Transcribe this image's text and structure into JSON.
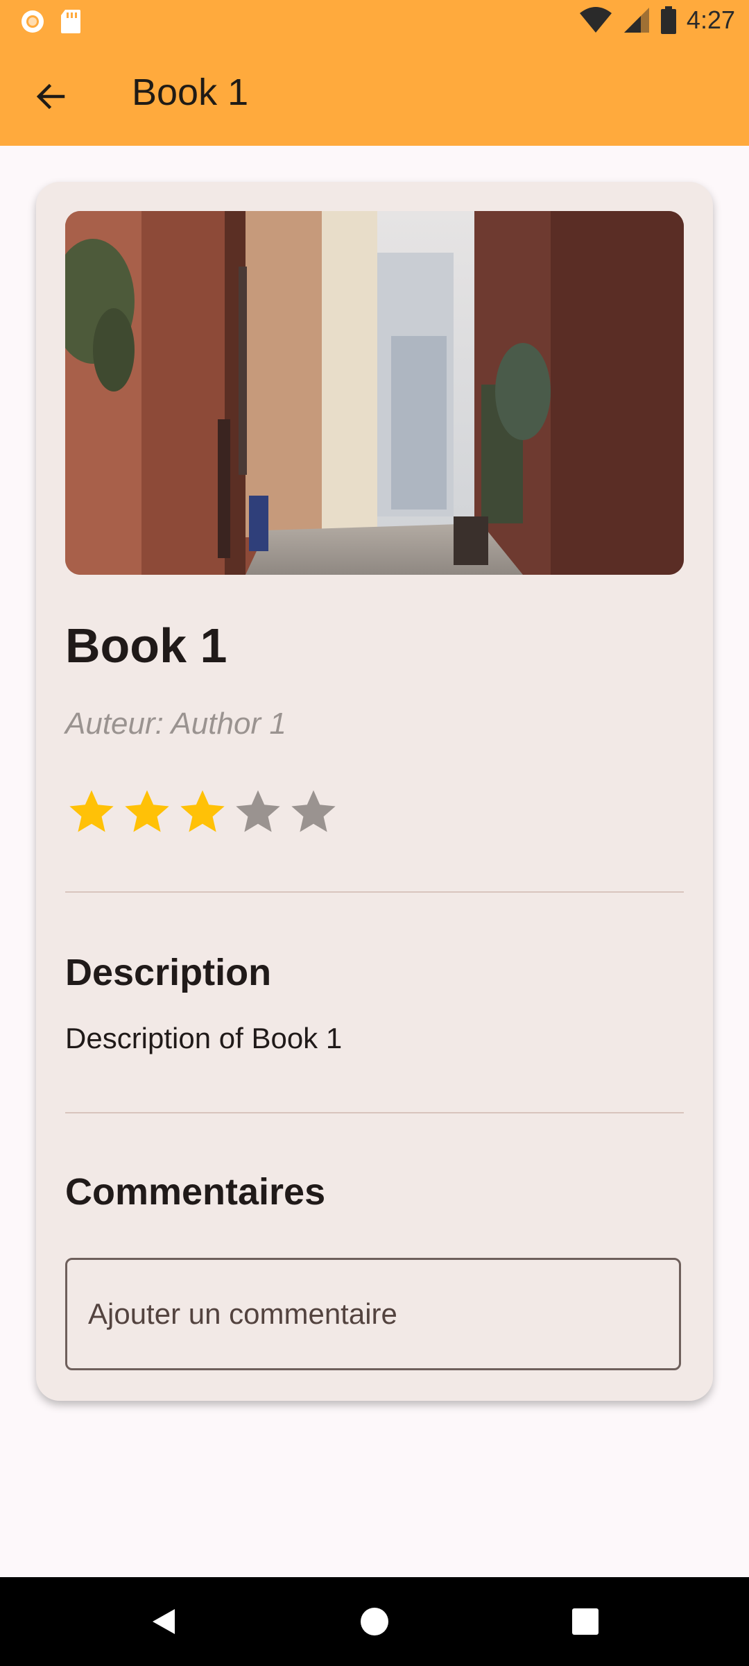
{
  "status_bar": {
    "time": "4:27",
    "left_icons": [
      "circle-notification-icon",
      "sd-card-icon"
    ],
    "right_icons": [
      "wifi-icon",
      "signal-icon",
      "battery-icon"
    ]
  },
  "app_bar": {
    "title": "Book 1",
    "back_icon": "arrow-back-icon",
    "background": "#ffaa3d"
  },
  "book": {
    "title": "Book 1",
    "author": "Auteur: Author 1",
    "image_icon": "alley-photo",
    "rating": 3,
    "rating_max": 5,
    "star_color_filled": "#ffc107",
    "star_color_empty": "#9a9390"
  },
  "description": {
    "heading": "Description",
    "text": "Description of Book 1"
  },
  "comments": {
    "heading": "Commentaires",
    "input_placeholder": "Ajouter un commentaire",
    "input_value": ""
  },
  "nav_bar": {
    "buttons": [
      "back-triangle-icon",
      "home-circle-icon",
      "recents-square-icon"
    ]
  }
}
